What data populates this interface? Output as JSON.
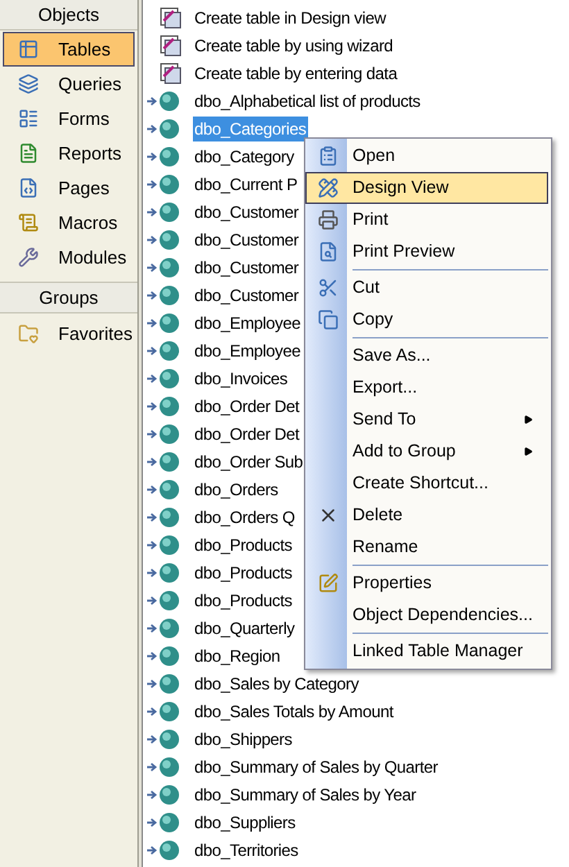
{
  "objects_bar": {
    "header": "Objects",
    "items": [
      {
        "label": "Tables",
        "kind": "tables",
        "selected": true
      },
      {
        "label": "Queries",
        "kind": "queries",
        "selected": false
      },
      {
        "label": "Forms",
        "kind": "forms",
        "selected": false
      },
      {
        "label": "Reports",
        "kind": "reports",
        "selected": false
      },
      {
        "label": "Pages",
        "kind": "pages",
        "selected": false
      },
      {
        "label": "Macros",
        "kind": "macros",
        "selected": false
      },
      {
        "label": "Modules",
        "kind": "modules",
        "selected": false
      }
    ]
  },
  "groups_bar": {
    "header": "Groups",
    "items": [
      {
        "label": "Favorites",
        "kind": "favorites",
        "selected": false
      }
    ]
  },
  "list": [
    {
      "label": "Create table in Design view",
      "kind": "shortcut",
      "selected": false
    },
    {
      "label": "Create table by using wizard",
      "kind": "shortcut",
      "selected": false
    },
    {
      "label": "Create table by entering data",
      "kind": "shortcut",
      "selected": false
    },
    {
      "label": "dbo_Alphabetical list of products",
      "kind": "linked",
      "selected": false
    },
    {
      "label": "dbo_Categories",
      "kind": "linked",
      "selected": true
    },
    {
      "label": "dbo_Category",
      "kind": "linked",
      "selected": false
    },
    {
      "label": "dbo_Current P",
      "kind": "linked",
      "selected": false
    },
    {
      "label": "dbo_Customer",
      "kind": "linked",
      "selected": false
    },
    {
      "label": "dbo_Customer",
      "kind": "linked",
      "selected": false
    },
    {
      "label": "dbo_Customer",
      "kind": "linked",
      "selected": false
    },
    {
      "label": "dbo_Customer",
      "kind": "linked",
      "selected": false
    },
    {
      "label": "dbo_Employee",
      "kind": "linked",
      "selected": false
    },
    {
      "label": "dbo_Employee",
      "kind": "linked",
      "selected": false
    },
    {
      "label": "dbo_Invoices",
      "kind": "linked",
      "selected": false
    },
    {
      "label": "dbo_Order Det",
      "kind": "linked",
      "selected": false
    },
    {
      "label": "dbo_Order Det",
      "kind": "linked",
      "selected": false
    },
    {
      "label": "dbo_Order Sub",
      "kind": "linked",
      "selected": false
    },
    {
      "label": "dbo_Orders",
      "kind": "linked",
      "selected": false
    },
    {
      "label": "dbo_Orders Q",
      "kind": "linked",
      "selected": false
    },
    {
      "label": "dbo_Products",
      "kind": "linked",
      "selected": false
    },
    {
      "label": "dbo_Products",
      "kind": "linked",
      "selected": false
    },
    {
      "label": "dbo_Products",
      "kind": "linked",
      "selected": false
    },
    {
      "label": "dbo_Quarterly",
      "kind": "linked",
      "selected": false
    },
    {
      "label": "dbo_Region",
      "kind": "linked",
      "selected": false
    },
    {
      "label": "dbo_Sales by Category",
      "kind": "linked",
      "selected": false
    },
    {
      "label": "dbo_Sales Totals by Amount",
      "kind": "linked",
      "selected": false
    },
    {
      "label": "dbo_Shippers",
      "kind": "linked",
      "selected": false
    },
    {
      "label": "dbo_Summary of Sales by Quarter",
      "kind": "linked",
      "selected": false
    },
    {
      "label": "dbo_Summary of Sales by Year",
      "kind": "linked",
      "selected": false
    },
    {
      "label": "dbo_Suppliers",
      "kind": "linked",
      "selected": false
    },
    {
      "label": "dbo_Territories",
      "kind": "linked",
      "selected": false
    }
  ],
  "context_menu": {
    "groups": [
      [
        {
          "label": "Open",
          "kind": "open",
          "selected": false,
          "submenu": false
        },
        {
          "label": "Design View",
          "kind": "design",
          "selected": true,
          "submenu": false
        },
        {
          "label": "Print",
          "kind": "print",
          "selected": false,
          "submenu": false
        },
        {
          "label": "Print Preview",
          "kind": "preview",
          "selected": false,
          "submenu": false
        }
      ],
      [
        {
          "label": "Cut",
          "kind": "cut",
          "selected": false,
          "submenu": false
        },
        {
          "label": "Copy",
          "kind": "copy",
          "selected": false,
          "submenu": false
        }
      ],
      [
        {
          "label": "Save As...",
          "kind": "plain",
          "selected": false,
          "submenu": false
        },
        {
          "label": "Export...",
          "kind": "plain",
          "selected": false,
          "submenu": false
        },
        {
          "label": "Send To",
          "kind": "plain",
          "selected": false,
          "submenu": true
        },
        {
          "label": "Add to Group",
          "kind": "plain",
          "selected": false,
          "submenu": true
        },
        {
          "label": "Create Shortcut...",
          "kind": "plain",
          "selected": false,
          "submenu": false
        },
        {
          "label": "Delete",
          "kind": "delete",
          "selected": false,
          "submenu": false
        },
        {
          "label": "Rename",
          "kind": "plain",
          "selected": false,
          "submenu": false
        }
      ],
      [
        {
          "label": "Properties",
          "kind": "properties",
          "selected": false,
          "submenu": false
        },
        {
          "label": "Object Dependencies...",
          "kind": "plain",
          "selected": false,
          "submenu": false
        }
      ],
      [
        {
          "label": "Linked Table Manager",
          "kind": "plain",
          "selected": false,
          "submenu": false
        }
      ]
    ]
  }
}
